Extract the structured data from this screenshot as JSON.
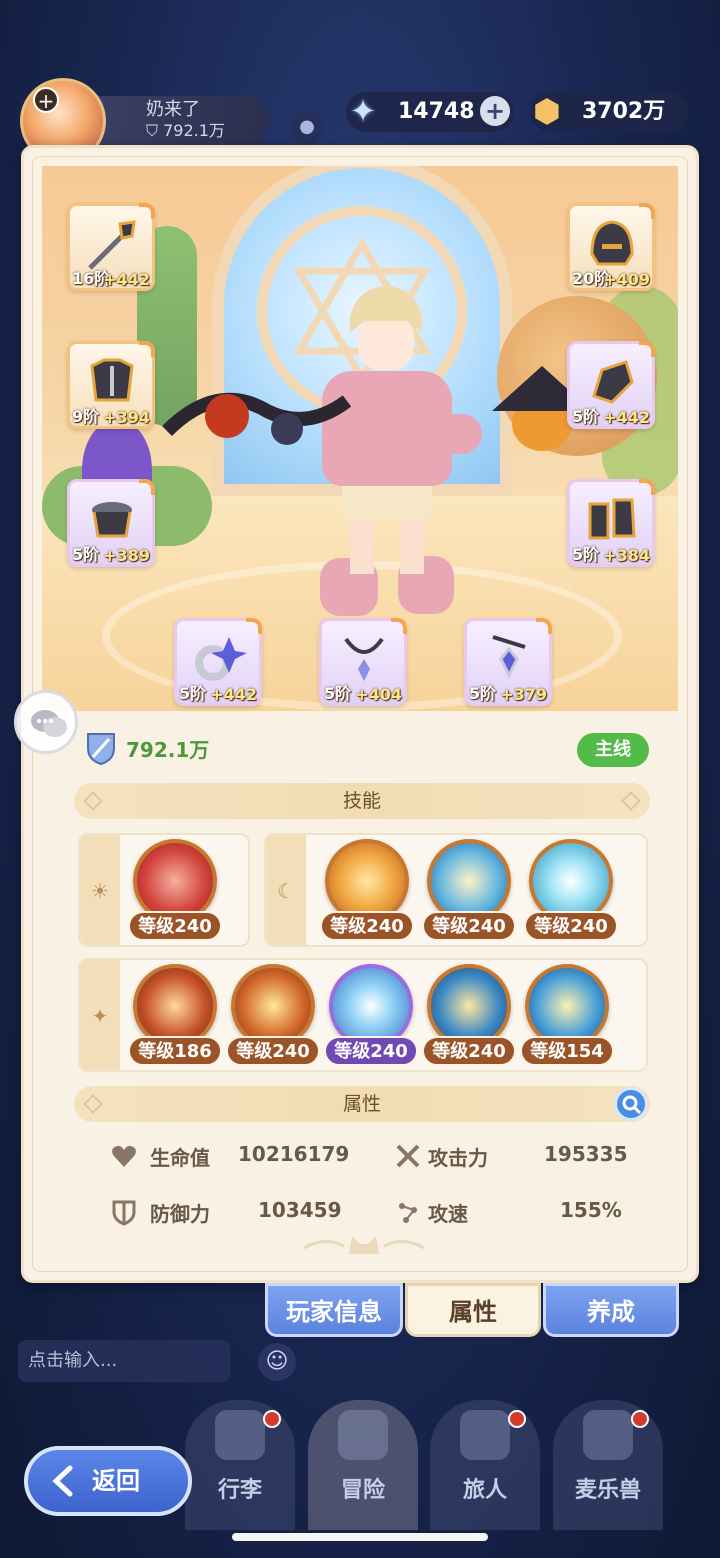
{
  "player": {
    "name": "奶来了",
    "power": "792.1万"
  },
  "currency": {
    "star_value": "14748",
    "gold_value": "3702万",
    "plus_symbol": "+"
  },
  "equipment": [
    {
      "slot": "weapon",
      "tier": "16阶",
      "bonus": "+442"
    },
    {
      "slot": "helmet",
      "tier": "20阶",
      "bonus": "+409"
    },
    {
      "slot": "armor",
      "tier": "9阶",
      "bonus": "+394"
    },
    {
      "slot": "gloves",
      "tier": "5阶",
      "bonus": "+442"
    },
    {
      "slot": "belt",
      "tier": "5阶",
      "bonus": "+389"
    },
    {
      "slot": "boots",
      "tier": "5阶",
      "bonus": "+384"
    },
    {
      "slot": "ring",
      "tier": "5阶",
      "bonus": "+442"
    },
    {
      "slot": "necklace",
      "tier": "5阶",
      "bonus": "+404"
    },
    {
      "slot": "amulet",
      "tier": "5阶",
      "bonus": "+379"
    }
  ],
  "power_display": "792.1万",
  "tag_main_line": "主线",
  "skills_section": {
    "title": "技能",
    "sun_skills": [
      {
        "level": "等级240"
      }
    ],
    "moon_skills": [
      {
        "level": "等级240"
      },
      {
        "level": "等级240"
      },
      {
        "level": "等级240"
      }
    ],
    "star_skills": [
      {
        "level": "等级186"
      },
      {
        "level": "等级240"
      },
      {
        "level": "等级240"
      },
      {
        "level": "等级240"
      },
      {
        "level": "等级154"
      }
    ]
  },
  "attributes_section": {
    "title": "属性",
    "hp_label": "生命值",
    "hp_value": "10216179",
    "atk_label": "攻击力",
    "atk_value": "195335",
    "def_label": "防御力",
    "def_value": "103459",
    "spd_label": "攻速",
    "spd_value": "155%"
  },
  "tabs": {
    "player_info": "玩家信息",
    "attributes": "属性",
    "cultivate": "养成"
  },
  "chat": {
    "placeholder": "点击输入..."
  },
  "nav": {
    "luggage": "行李",
    "adventure": "冒险",
    "traveler": "旅人",
    "mailebeast": "麦乐兽"
  },
  "back_label": "返回",
  "colors": {
    "accent_blue": "#5b82de",
    "panel_bg": "#f8f1e4",
    "power_green": "#4b9a3a",
    "tag_green": "#53bb4a",
    "level_badge": "#9b5428"
  }
}
